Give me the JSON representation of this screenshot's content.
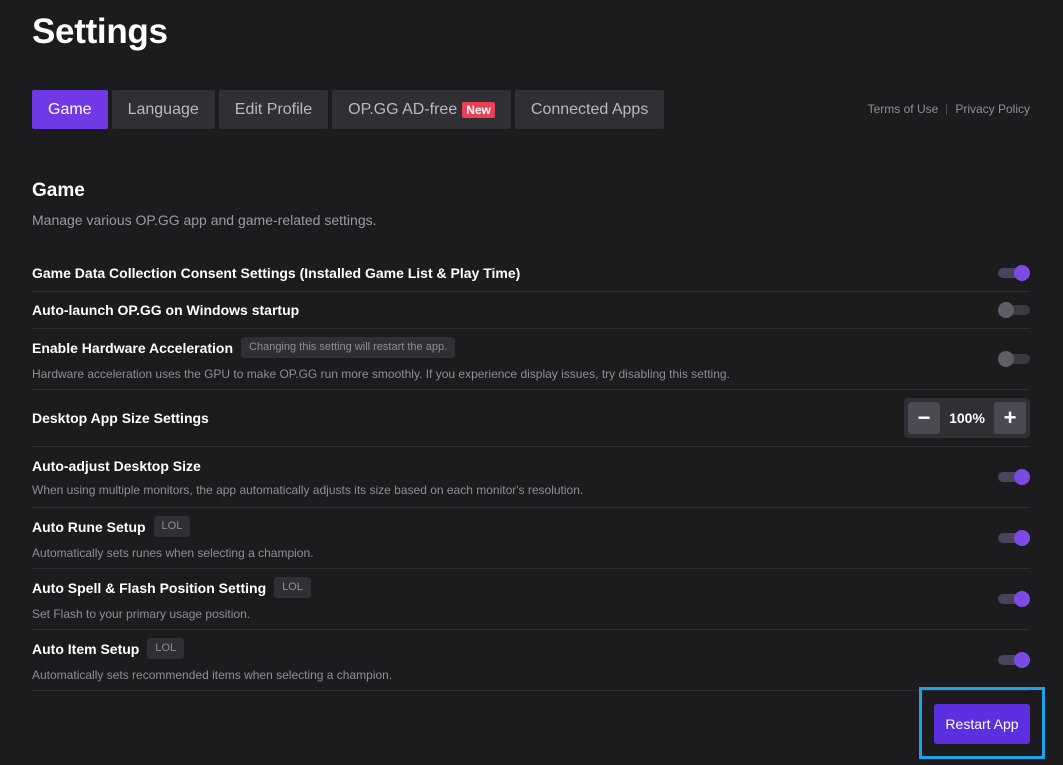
{
  "page": {
    "title": "Settings"
  },
  "tabs": [
    {
      "label": "Game",
      "active": true
    },
    {
      "label": "Language",
      "active": false
    },
    {
      "label": "Edit Profile",
      "active": false
    },
    {
      "label": "OP.GG AD-free",
      "badge": "New",
      "active": false
    },
    {
      "label": "Connected Apps",
      "active": false
    }
  ],
  "legal": {
    "terms": "Terms of Use",
    "privacy": "Privacy Policy"
  },
  "section": {
    "title": "Game",
    "description": "Manage various OP.GG app and game-related settings."
  },
  "settings": [
    {
      "label": "Game Data Collection Consent Settings (Installed Game List & Play Time)",
      "enabled": true
    },
    {
      "label": "Auto-launch OP.GG on Windows startup",
      "enabled": false
    },
    {
      "label": "Enable Hardware Acceleration",
      "tag": "Changing this setting will restart the app.",
      "description": "Hardware acceleration uses the GPU to make OP.GG run more smoothly. If you experience display issues, try disabling this setting.",
      "enabled": false
    },
    {
      "label": "Desktop App Size Settings",
      "stepper": {
        "minus": "−",
        "value": "100%",
        "plus": "+"
      }
    },
    {
      "label": "Auto-adjust Desktop Size",
      "description": "When using multiple monitors, the app automatically adjusts its size based on each monitor's resolution.",
      "enabled": true
    },
    {
      "label": "Auto Rune Setup",
      "tag": "LOL",
      "description": "Automatically sets runes when selecting a champion.",
      "enabled": true
    },
    {
      "label": "Auto Spell & Flash Position Setting",
      "tag": "LOL",
      "description": "Set Flash to your primary usage position.",
      "enabled": true
    },
    {
      "label": "Auto Item Setup",
      "tag": "LOL",
      "description": "Automatically sets recommended items when selecting a champion.",
      "enabled": true
    }
  ],
  "footer": {
    "restart_label": "Restart App"
  },
  "colors": {
    "accent": "#6f3ae6",
    "toggle_on": "#7b4be6",
    "badge_new": "#e84057",
    "highlight": "#1ea1e8",
    "background": "#1c1c1f"
  }
}
